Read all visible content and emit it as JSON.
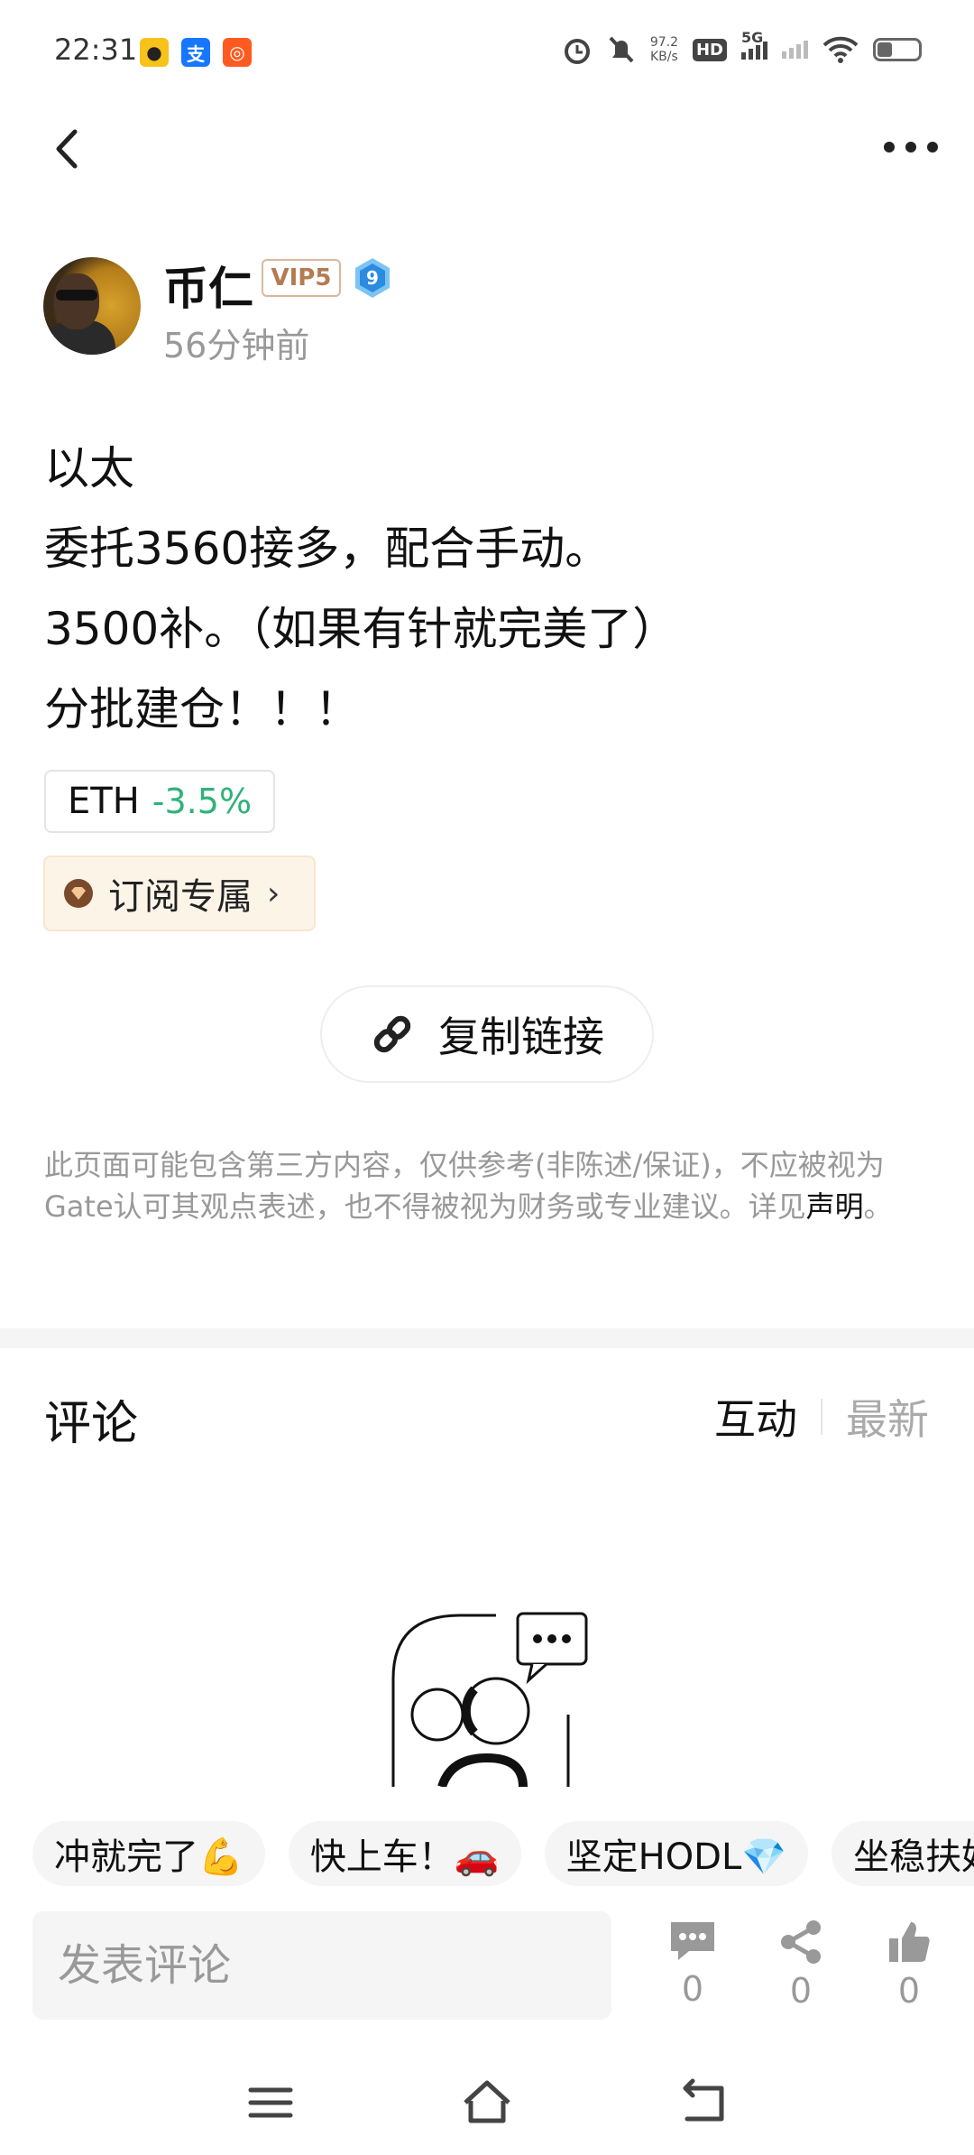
{
  "status_bar": {
    "time": "22:31",
    "net_speed_value": "97.2",
    "net_speed_unit": "KB/s",
    "hd": "HD",
    "network": "5G"
  },
  "author": {
    "name": "币仁",
    "vip": "VIP5",
    "level": "9",
    "time_ago": "56分钟前"
  },
  "post": {
    "lines": [
      "以太",
      "委托3560接多，配合手动。",
      "3500补。（如果有针就完美了）",
      "分批建仓！！！"
    ]
  },
  "coin_tag": {
    "symbol": "ETH",
    "change": "-3.5%"
  },
  "subscribe": {
    "label": "订阅专属"
  },
  "copy_link": {
    "label": "复制链接"
  },
  "disclaimer": {
    "text": "此页面可能包含第三方内容，仅供参考(非陈述/保证)，不应被视为Gate认可其观点表述，也不得被视为财务或专业建议。详见",
    "link": "声明",
    "end": "。"
  },
  "comments": {
    "title": "评论",
    "sort_active": "互动",
    "sort_inactive": "最新"
  },
  "quick_replies": [
    "冲就完了💪",
    "快上车！🚗",
    "坚定HODL💎",
    "坐稳扶好"
  ],
  "composer": {
    "placeholder": "发表评论"
  },
  "actions": {
    "comment_count": "0",
    "share_count": "0",
    "like_count": "0"
  },
  "colors": {
    "positive_change": "#2fb27a",
    "vip_border": "#d9b99b",
    "subscribe_bg": "#fdf4e8"
  }
}
